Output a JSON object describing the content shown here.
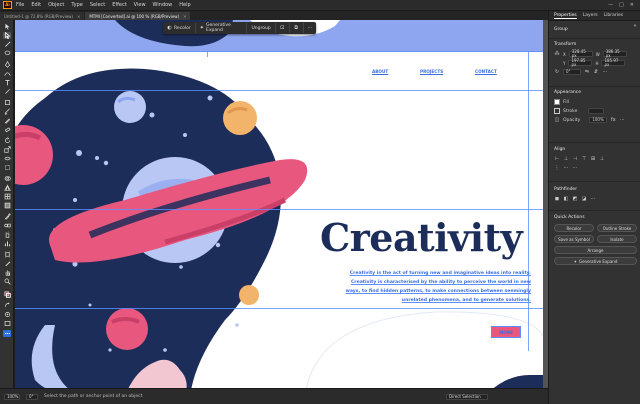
{
  "app": {
    "logo": "Ai",
    "menus": [
      "File",
      "Edit",
      "Object",
      "Type",
      "Select",
      "Effect",
      "View",
      "Window",
      "Help"
    ]
  },
  "tabs": [
    {
      "label": "Untitled-1 @ 72.8% (RGB/Preview)",
      "active": false
    },
    {
      "label": "MTMI [Converted].ai @ 100 % (RGB/Preview)",
      "active": true
    }
  ],
  "context_bar": {
    "recolor": "Recolor",
    "generative_expand": "Generative Expand",
    "ungroup": "Ungroup",
    "more": "···"
  },
  "artwork": {
    "headline": "Creativity",
    "nav_links": [
      "ABOUT",
      "PROJECTS",
      "CONTACT"
    ],
    "body": "Creativity is the act of turning new and imaginative ideas into reality. Creativity is characterised by the ability to perceive the world in new ways, to find hidden patterns, to make connections between seemingly unrelated phenomena, and to generate solutions.",
    "cta": "MORE",
    "colors": {
      "navy": "#1d2d5a",
      "pink": "#e8577e",
      "periwinkle": "#8ea6f0",
      "orange": "#f2b36a",
      "lightblue": "#b9c7f5",
      "selection": "#5b8fff"
    }
  },
  "panel": {
    "tabs": [
      "Properties",
      "Layers",
      "Libraries"
    ],
    "group_label": "Group",
    "transform_title": "Transform",
    "x": "328.45 px",
    "y": "197.85 px",
    "w": "386.35 px",
    "h": "185.97 px",
    "angle": "0°",
    "appearance_title": "Appearance",
    "fill_label": "Fill",
    "stroke_label": "Stroke",
    "opacity_label": "Opacity",
    "opacity_value": "100%",
    "align_title": "Align",
    "pathfinder_title": "Pathfinder",
    "quick_actions_title": "Quick Actions",
    "quick_actions": [
      "Recolor",
      "Outline Stroke",
      "Save as Symbol",
      "Isolate",
      "Arrange",
      "Generative Expand"
    ]
  },
  "status": {
    "zoom": "100%",
    "angle": "0°",
    "hint": "Select the path or anchor point of an object",
    "selection": "Direct Selection"
  }
}
